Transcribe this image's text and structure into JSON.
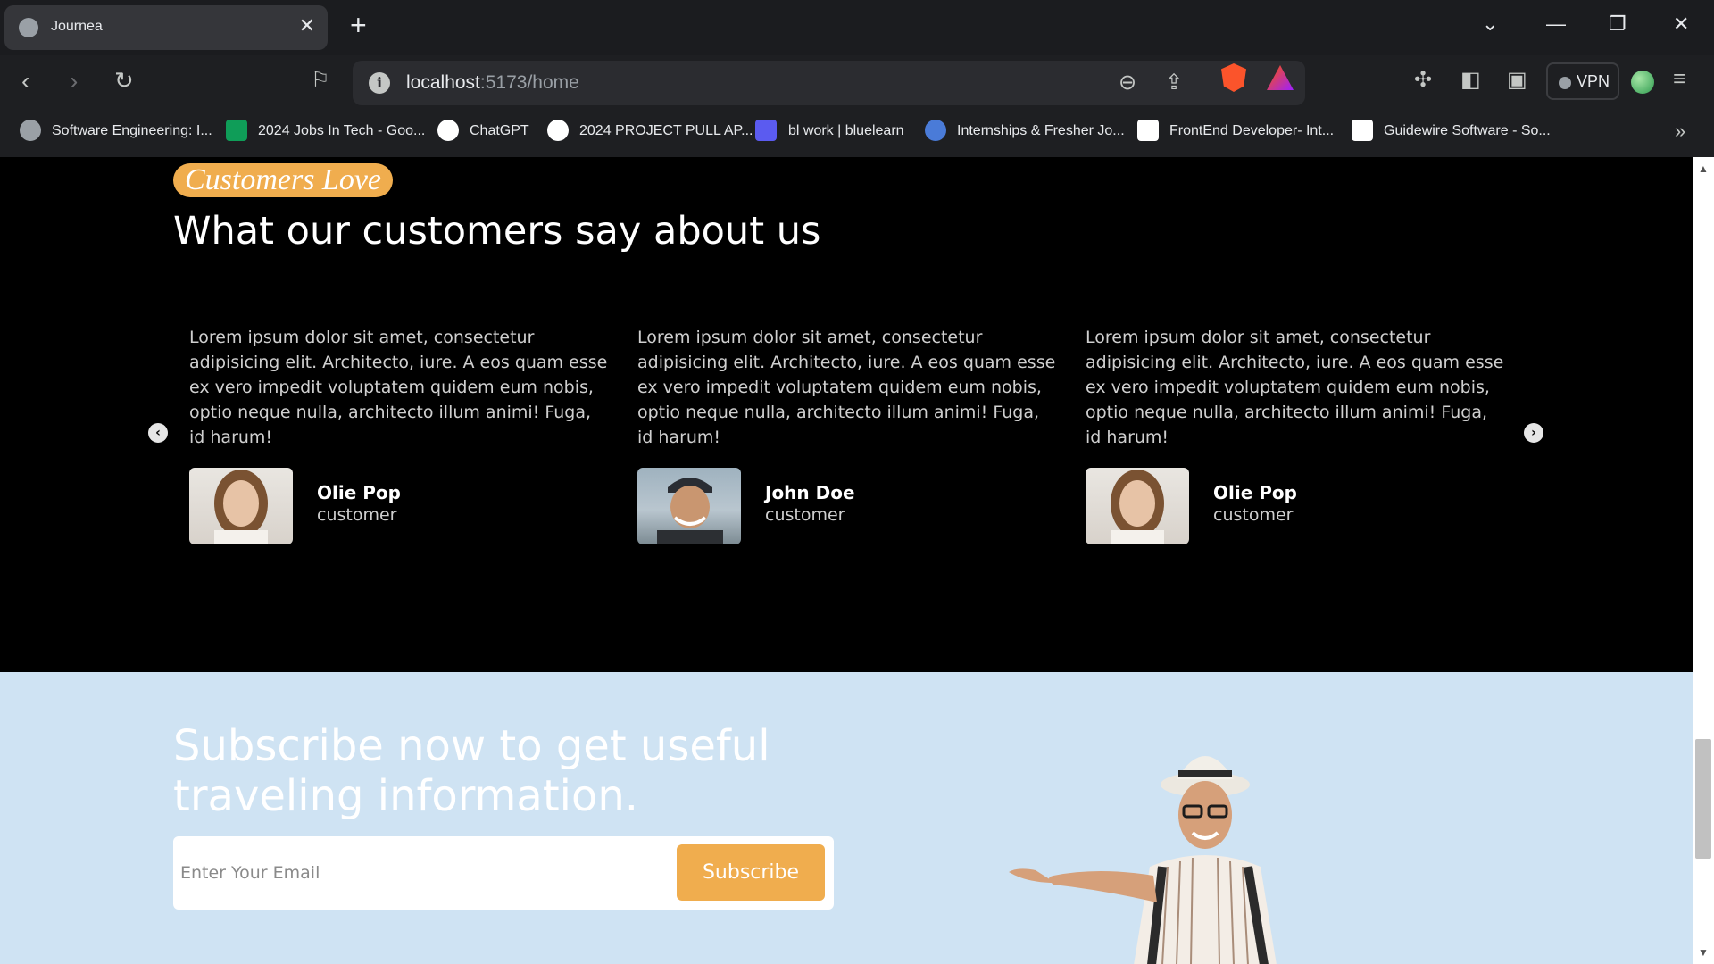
{
  "browser": {
    "tab_title": "Journea",
    "url_host": "localhost",
    "url_rest": ":5173/home",
    "vpn_label": "VPN",
    "bookmarks": [
      {
        "label": "Software Engineering: I...",
        "icon": "globe-icon",
        "color": "#9aa0a6"
      },
      {
        "label": "2024 Jobs In Tech - Goo...",
        "icon": "sheets-icon",
        "color": "#0f9d58"
      },
      {
        "label": "ChatGPT",
        "icon": "chatgpt-icon",
        "color": "#ffffff"
      },
      {
        "label": "2024 PROJECT PULL AP...",
        "icon": "google-icon",
        "color": "#ffffff"
      },
      {
        "label": "bl work | bluelearn",
        "icon": "bluelearn-icon",
        "color": "#5b5bf0"
      },
      {
        "label": "Internships & Fresher Jo...",
        "icon": "rocket-icon",
        "color": "#4a7bd8"
      },
      {
        "label": "FrontEnd Developer- Int...",
        "icon": "w-icon",
        "color": "#ffffff"
      },
      {
        "label": "Guidewire Software - So...",
        "icon": "pen-icon",
        "color": "#ffffff"
      }
    ]
  },
  "testimonials": {
    "badge": "Customers Love",
    "title": "What our customers say about us",
    "cards": [
      {
        "quote": "Lorem ipsum dolor sit amet, consectetur adipisicing elit. Architecto, iure. A eos quam esse ex vero impedit voluptatem quidem eum nobis, optio neque nulla, architecto illum animi! Fuga, id harum!",
        "name": "Olie Pop",
        "role": "customer"
      },
      {
        "quote": "Lorem ipsum dolor sit amet, consectetur adipisicing elit. Architecto, iure. A eos quam esse ex vero impedit voluptatem quidem eum nobis, optio neque nulla, architecto illum animi! Fuga, id harum!",
        "name": "John Doe",
        "role": "customer"
      },
      {
        "quote": "Lorem ipsum dolor sit amet, consectetur adipisicing elit. Architecto, iure. A eos quam esse ex vero impedit voluptatem quidem eum nobis, optio neque nulla, architecto illum animi! Fuga, id harum!",
        "name": "Olie Pop",
        "role": "customer"
      }
    ]
  },
  "subscribe": {
    "title": "Subscribe now to get useful traveling information.",
    "email_placeholder": "Enter Your Email",
    "button_label": "Subscribe"
  },
  "colors": {
    "accent": "#f0ad4e",
    "section_dark": "#000000",
    "subscribe_bg": "#cfe3f3"
  }
}
